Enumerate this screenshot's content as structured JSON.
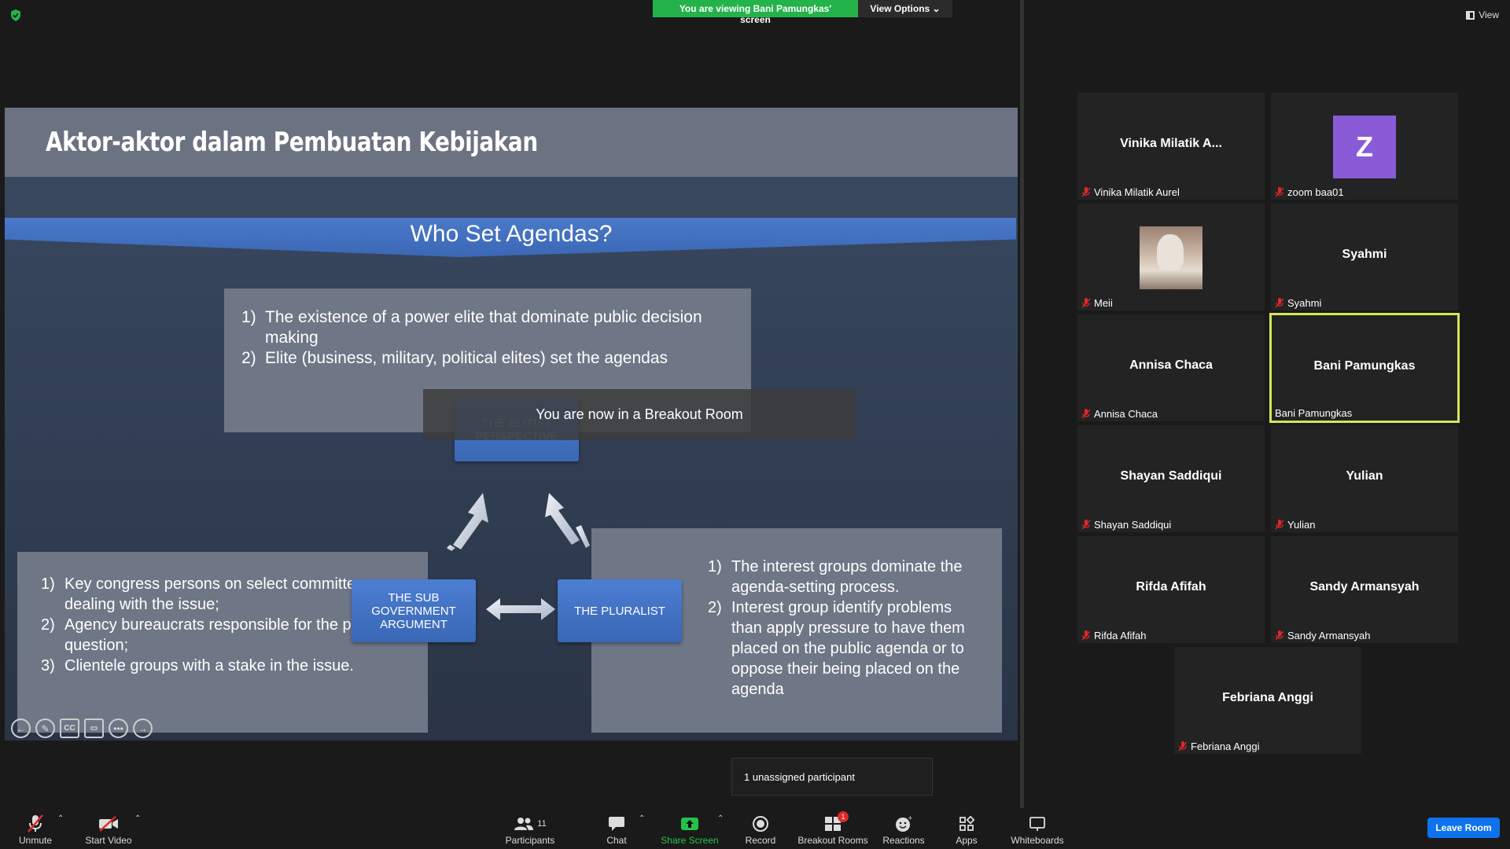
{
  "banner": {
    "sharing_text": "You are viewing Bani Pamungkas' screen",
    "view_options": "View Options ⌄"
  },
  "view_label": "View",
  "slide": {
    "header_title": "Aktor-aktor dalam Pembuatan Kebijakan",
    "agenda_title": "Who Set Agendas?",
    "box1": [
      {
        "n": "1)",
        "text": "The existence of a power elite that dominate public decision making"
      },
      {
        "n": "2)",
        "text": "Elite (business, military, political elites) set the agendas"
      }
    ],
    "box2": [
      {
        "n": "1)",
        "text": "Key congress persons on select committees dealing with the issue;"
      },
      {
        "n": "2)",
        "text": "Agency bureaucrats responsible for the policy in question;"
      },
      {
        "n": "3)",
        "text": "Clientele groups with a stake in the issue."
      }
    ],
    "box3": [
      {
        "n": "1)",
        "text": "The interest groups dominate the agenda-setting process."
      },
      {
        "n": "2)",
        "text": "Interest group identify problems than apply pressure to have them placed on the public agenda or to oppose their being placed on the agenda"
      }
    ],
    "node_elitist": "THE ELITIST PERSPECTIVE",
    "node_sub": "THE SUB GOVERNMENT ARGUMENT",
    "node_plural": "THE PLURALIST",
    "toast": "You are now in a Breakout Room"
  },
  "participants": [
    {
      "display": "Vinika Milatik A...",
      "label": "Vinika Milatik Aurel"
    },
    {
      "display": "Z",
      "label": "zoom baa01"
    },
    {
      "display": "",
      "label": "Meii"
    },
    {
      "display": "Syahmi",
      "label": "Syahmi"
    },
    {
      "display": "Annisa Chaca",
      "label": "Annisa Chaca"
    },
    {
      "display": "Bani Pamungkas",
      "label": "Bani Pamungkas"
    },
    {
      "display": "Shayan Saddiqui",
      "label": "Shayan Saddiqui"
    },
    {
      "display": "Yulian",
      "label": "Yulian"
    },
    {
      "display": "Rifda Afifah",
      "label": "Rifda Afifah"
    },
    {
      "display": "Sandy Armansyah",
      "label": "Sandy Armansyah"
    },
    {
      "display": "Febriana Anggi",
      "label": "Febriana Anggi"
    }
  ],
  "unassigned": "1 unassigned participant",
  "toolbar": {
    "unmute": "Unmute",
    "start_video": "Start Video",
    "participants": "Participants",
    "participants_count": "11",
    "chat": "Chat",
    "share_screen": "Share Screen",
    "record": "Record",
    "breakout_rooms": "Breakout Rooms",
    "breakout_badge": "1",
    "reactions": "Reactions",
    "apps": "Apps",
    "whiteboards": "Whiteboards",
    "leave_room": "Leave Room"
  },
  "colors": {
    "share_green": "#24b34b",
    "active_speaker": "#d6e55a",
    "leave_blue": "#0e72ed",
    "avatar_purple": "#8a5bd6"
  }
}
